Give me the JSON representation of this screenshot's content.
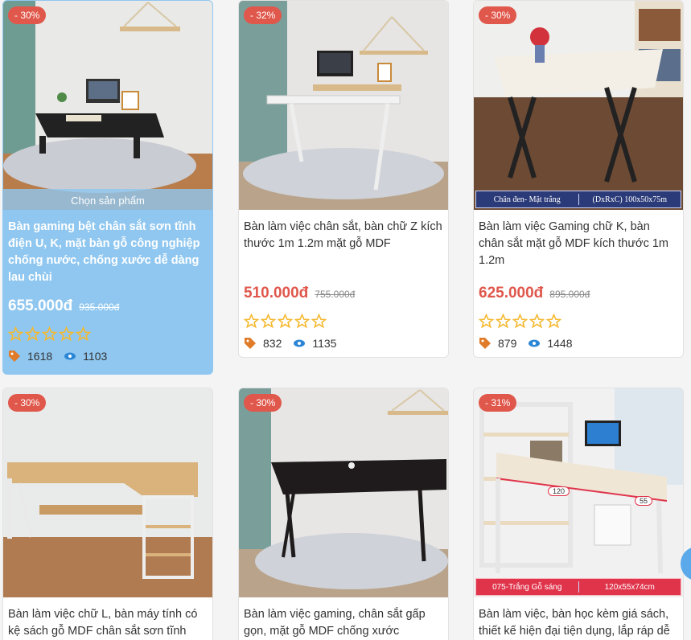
{
  "colors": {
    "accent": "#e0574b",
    "hover": "#8fc7f0",
    "star": "#f5b82e"
  },
  "products": [
    {
      "discount": "- 30%",
      "title": "Bàn gaming bệt chân sắt sơn tĩnh điện U, K, mặt bàn gỗ công nghiệp chống nước, chống xước dễ dàng lau chùi",
      "price": "655.000đ",
      "old_price": "935.000đ",
      "likes": "1618",
      "views": "1103",
      "overlay": "Chọn sản phẩm",
      "rating": 0
    },
    {
      "discount": "- 32%",
      "title": "Bàn làm việc chân sắt, bàn chữ Z kích thước 1m 1.2m mặt gỗ MDF",
      "price": "510.000đ",
      "old_price": "755.000đ",
      "likes": "832",
      "views": "1135",
      "rating": 0
    },
    {
      "discount": "- 30%",
      "title": "Bàn làm việc Gaming chữ K, bàn chân sắt mặt gỗ MDF kích thước 1m 1.2m",
      "price": "625.000đ",
      "old_price": "895.000đ",
      "likes": "879",
      "views": "1448",
      "strip_left": "Chân đen- Mặt trắng",
      "strip_right": "(DxRxC) 100x50x75m",
      "rating": 0
    },
    {
      "discount": "- 30%",
      "title": "Bàn làm việc chữ L, bàn máy tính có kệ sách gỗ MDF chân sắt sơn tĩnh điện",
      "rating": 0
    },
    {
      "discount": "- 30%",
      "title": "Bàn làm việc gaming, chân sắt gấp gọn, mặt gỗ MDF chống xước",
      "rating": 0
    },
    {
      "discount": "- 31%",
      "title": "Bàn làm việc, bàn học kèm giá sách, thiết kế hiện đại tiện dụng, lắp ráp dễ",
      "strip_left": "075-Trắng Gỗ sáng",
      "strip_right": "120x55x74cm",
      "tag_a": "120",
      "tag_b": "55",
      "rating": 0
    }
  ]
}
